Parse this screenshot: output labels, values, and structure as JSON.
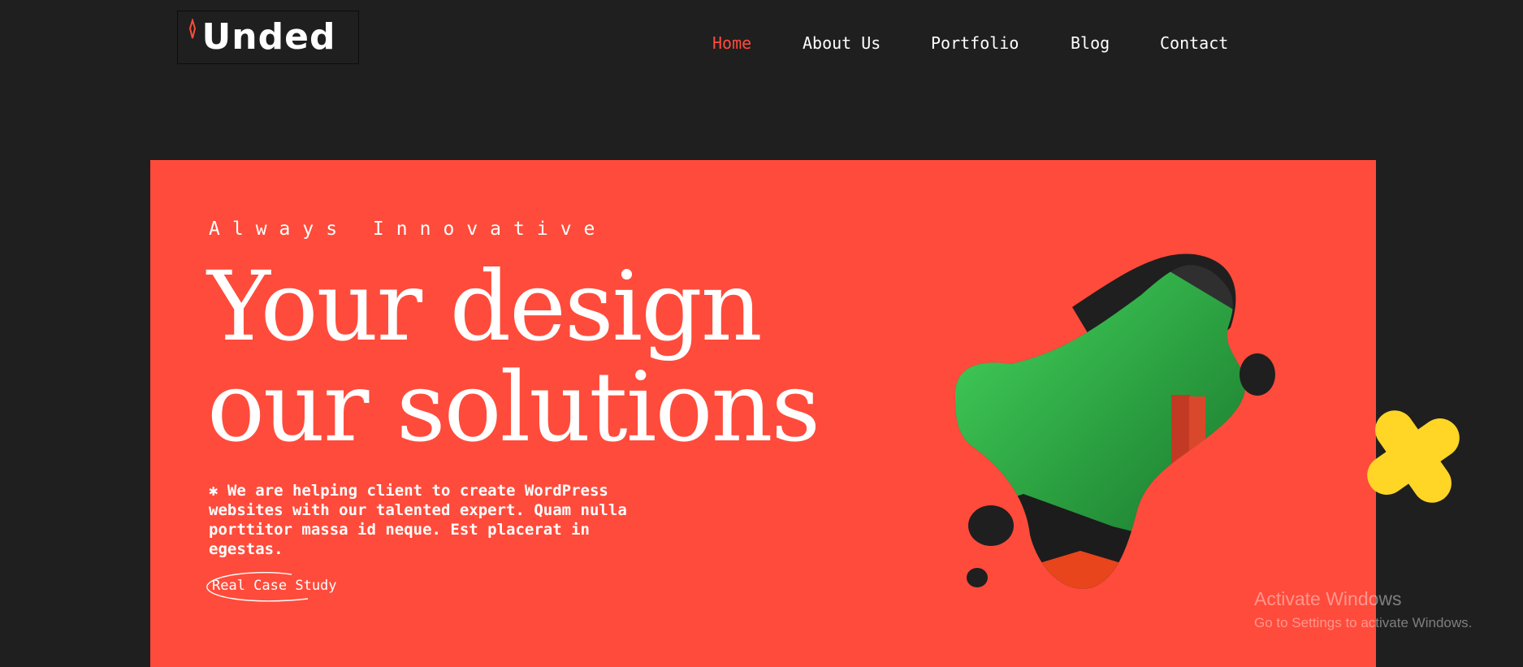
{
  "header": {
    "logo_text": "Unded",
    "nav": [
      {
        "label": "Home",
        "active": true
      },
      {
        "label": "About Us",
        "active": false
      },
      {
        "label": "Portfolio",
        "active": false
      },
      {
        "label": "Blog",
        "active": false
      },
      {
        "label": "Contact",
        "active": false
      }
    ]
  },
  "hero": {
    "eyebrow": "Always Innovative",
    "headline_line1": "Your design",
    "headline_line2": "our solutions",
    "description": "✱ We are helping client to create WordPress websites with our talented expert. Quam nulla porttitor massa id neque. Est placerat in egestas.",
    "cta_label": "Real Case Study"
  },
  "watermark": {
    "title": "Activate Windows",
    "subtitle": "Go to Settings to activate Windows."
  },
  "colors": {
    "background": "#1f1f1f",
    "accent": "#ff4b3b",
    "yellow": "#ffd526",
    "green": "#2fb84a"
  }
}
